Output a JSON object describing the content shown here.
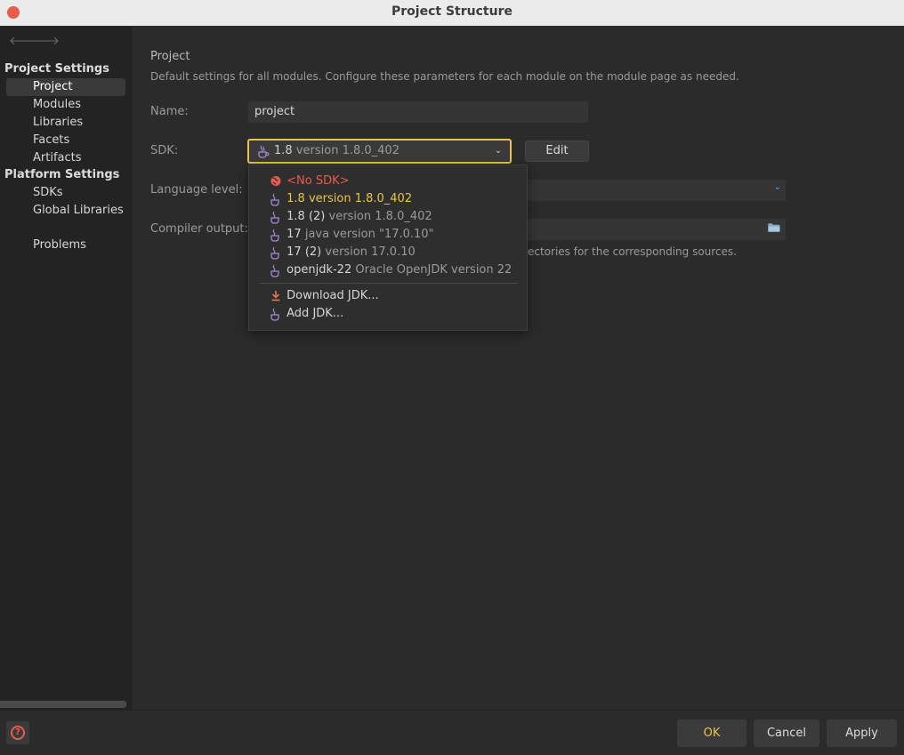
{
  "window": {
    "title": "Project Structure"
  },
  "nav": {
    "back": "🡐",
    "forward": "🡒"
  },
  "sidebar": {
    "section_project_settings": "Project Settings",
    "items_project": [
      {
        "label": "Project",
        "selected": true
      },
      {
        "label": "Modules"
      },
      {
        "label": "Libraries"
      },
      {
        "label": "Facets"
      },
      {
        "label": "Artifacts"
      }
    ],
    "section_platform_settings": "Platform Settings",
    "items_platform": [
      {
        "label": "SDKs"
      },
      {
        "label": "Global Libraries"
      }
    ],
    "problems": "Problems"
  },
  "main": {
    "heading": "Project",
    "description": "Default settings for all modules. Configure these parameters for each module on the module page as needed.",
    "name_label": "Name:",
    "name_value": "project",
    "sdk_label": "SDK:",
    "sdk_selected_name": "1.8",
    "sdk_selected_version": "version 1.8.0_402",
    "edit_label": "Edit",
    "language_level_label": "Language level:",
    "compiler_output_label": "Compiler output:",
    "compiler_hint": "ectories for the corresponding sources."
  },
  "sdk_dropdown": {
    "no_sdk": "<No SDK>",
    "options": [
      {
        "name": "1.8 version 1.8.0_402",
        "detail": "",
        "selected": true
      },
      {
        "name": "1.8 (2)",
        "detail": "version 1.8.0_402"
      },
      {
        "name": "17",
        "detail": "java version \"17.0.10\""
      },
      {
        "name": "17 (2)",
        "detail": "version 17.0.10"
      },
      {
        "name": "openjdk-22",
        "detail": "Oracle OpenJDK version 22"
      }
    ],
    "download_jdk": "Download JDK...",
    "add_jdk": "Add JDK..."
  },
  "footer": {
    "help": "?",
    "ok": "OK",
    "cancel": "Cancel",
    "apply": "Apply"
  },
  "colors": {
    "accent": "#e8c547",
    "error": "#e85b4f",
    "link": "#5aa9e6"
  },
  "icons": [
    "java-cup-icon",
    "no-sdk-icon",
    "download-icon",
    "folder-icon",
    "chevron-down-icon",
    "help-icon",
    "back-arrow-icon",
    "forward-arrow-icon"
  ]
}
